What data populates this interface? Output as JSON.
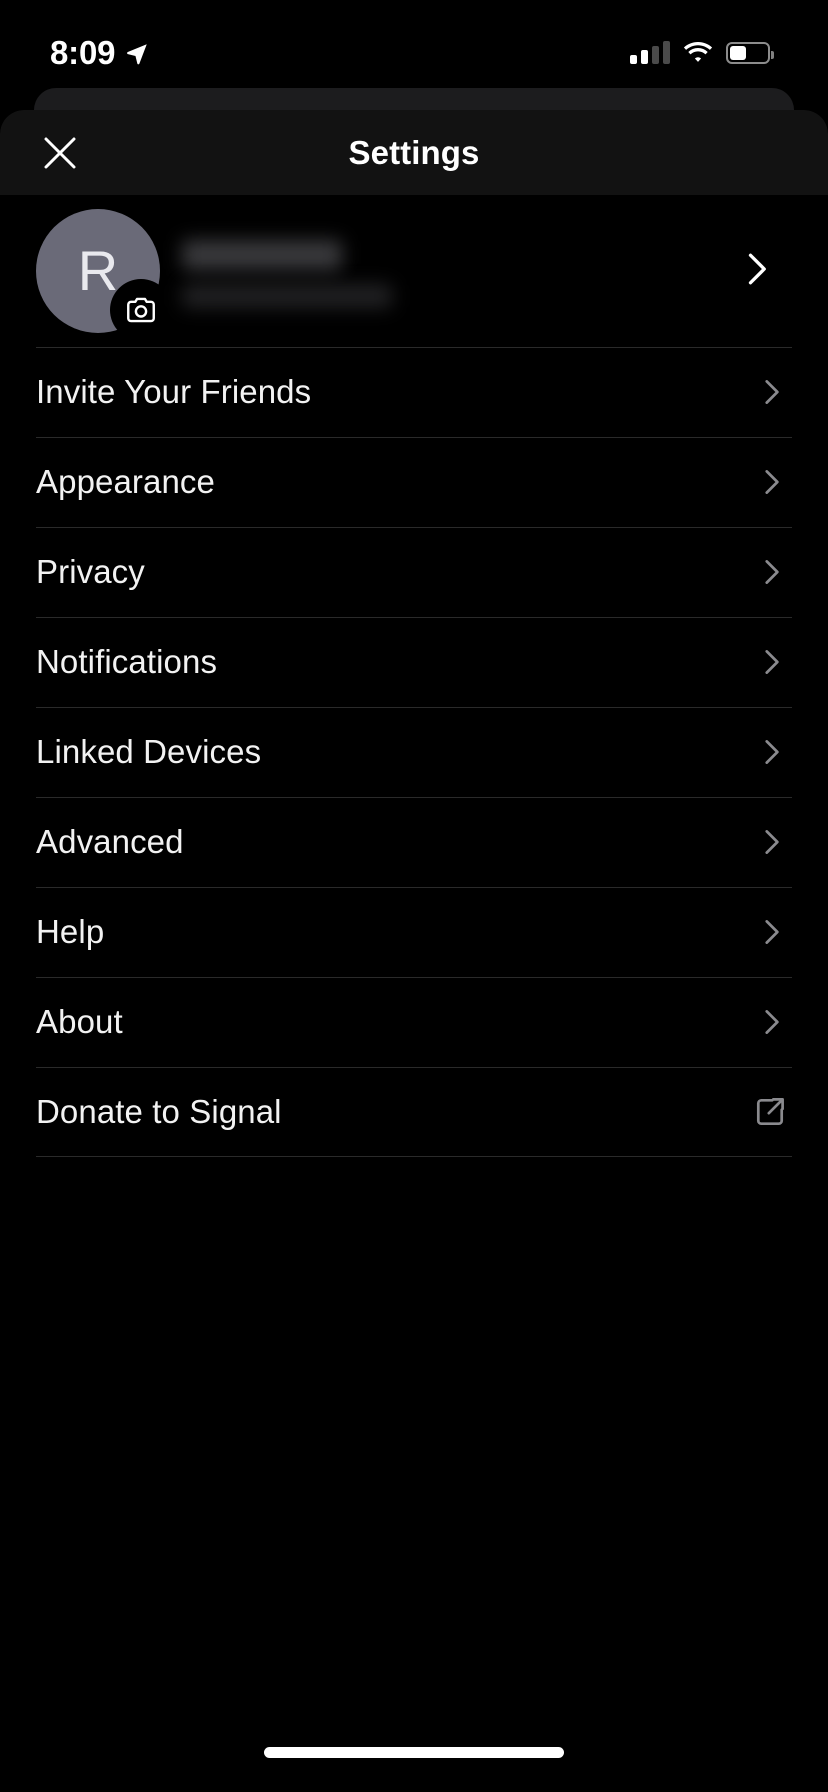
{
  "status_bar": {
    "time": "8:09",
    "location_icon": "location-arrow-icon",
    "signal_icon": "cellular-signal-icon",
    "signal_bars_filled": 2,
    "signal_bars_total": 4,
    "wifi_icon": "wifi-icon",
    "battery_icon": "battery-icon",
    "battery_level_percent": 45
  },
  "nav": {
    "close_icon": "close-icon",
    "title": "Settings"
  },
  "profile": {
    "avatar_initial": "R",
    "avatar_color": "#6a6a78",
    "camera_icon": "camera-icon",
    "name": "",
    "subtitle": "",
    "name_redacted": true,
    "subtitle_redacted": true,
    "chevron_icon": "chevron-right-icon"
  },
  "menu": {
    "items": [
      {
        "label": "Invite Your Friends",
        "icon": "chevron-right-icon",
        "name": "invite-your-friends"
      },
      {
        "label": "Appearance",
        "icon": "chevron-right-icon",
        "name": "appearance"
      },
      {
        "label": "Privacy",
        "icon": "chevron-right-icon",
        "name": "privacy"
      },
      {
        "label": "Notifications",
        "icon": "chevron-right-icon",
        "name": "notifications"
      },
      {
        "label": "Linked Devices",
        "icon": "chevron-right-icon",
        "name": "linked-devices"
      },
      {
        "label": "Advanced",
        "icon": "chevron-right-icon",
        "name": "advanced"
      },
      {
        "label": "Help",
        "icon": "chevron-right-icon",
        "name": "help"
      },
      {
        "label": "About",
        "icon": "chevron-right-icon",
        "name": "about"
      },
      {
        "label": "Donate to Signal",
        "icon": "external-link-icon",
        "name": "donate-to-signal"
      }
    ]
  },
  "home_indicator": {
    "label": "home-indicator"
  },
  "colors": {
    "background": "#000000",
    "navbar": "#121212",
    "separator": "#2a2a2a",
    "text_primary": "#f2f2f2",
    "chevron": "#8a8a8e",
    "avatar": "#6a6a78"
  }
}
